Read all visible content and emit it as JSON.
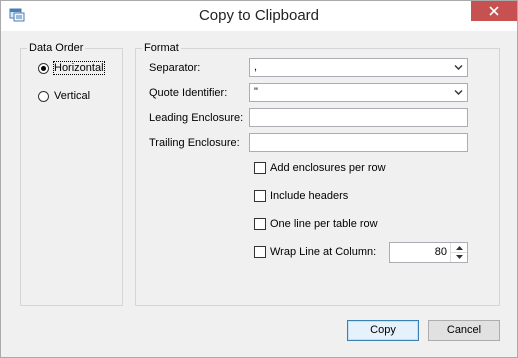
{
  "window": {
    "title": "Copy to Clipboard"
  },
  "data_order": {
    "legend": "Data Order",
    "options": [
      {
        "label": "Horizontal",
        "selected": true
      },
      {
        "label": "Vertical",
        "selected": false
      }
    ]
  },
  "format": {
    "legend": "Format",
    "separator": {
      "label": "Separator:",
      "value": ","
    },
    "quote_identifier": {
      "label": "Quote Identifier:",
      "value": "\""
    },
    "leading_enclosure": {
      "label": "Leading Enclosure:",
      "value": ""
    },
    "trailing_enclosure": {
      "label": "Trailing Enclosure:",
      "value": ""
    },
    "checkboxes": [
      {
        "label": "Add enclosures per row",
        "checked": false
      },
      {
        "label": "Include headers",
        "checked": false
      },
      {
        "label": "One line per table row",
        "checked": false
      },
      {
        "label": "Wrap Line at Column:",
        "checked": false
      }
    ],
    "wrap_column": "80"
  },
  "buttons": {
    "copy": "Copy",
    "cancel": "Cancel"
  },
  "colors": {
    "close_button": "#c75050",
    "default_button_border": "#3c7fb1"
  }
}
